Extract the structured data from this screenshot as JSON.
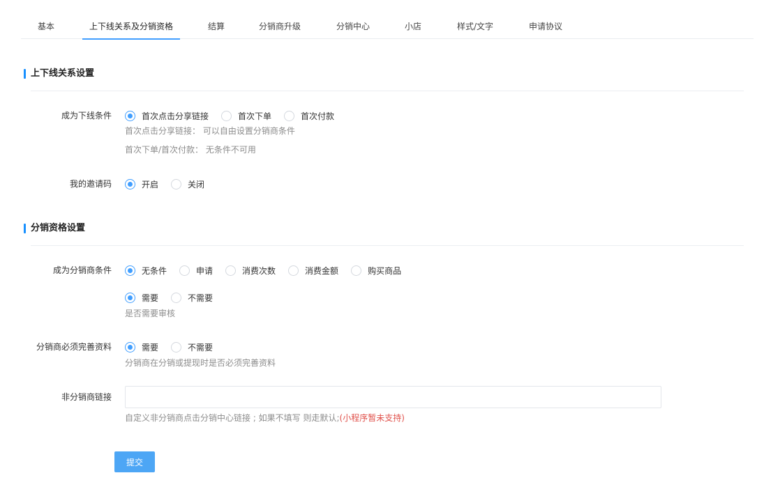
{
  "tabs": [
    {
      "label": "基本"
    },
    {
      "label": "上下线关系及分销资格",
      "active": true
    },
    {
      "label": "结算"
    },
    {
      "label": "分销商升级"
    },
    {
      "label": "分销中心"
    },
    {
      "label": "小店"
    },
    {
      "label": "样式/文字"
    },
    {
      "label": "申请协议"
    }
  ],
  "section_relation": {
    "title": "上下线关系设置",
    "downline_condition": {
      "label": "成为下线条件",
      "options": [
        "首次点击分享链接",
        "首次下单",
        "首次付款"
      ],
      "selected": 0,
      "help1": "首次点击分享链接： 可以自由设置分销商条件",
      "help2": "首次下单/首次付款： 无条件不可用"
    },
    "invite_code": {
      "label": "我的邀请码",
      "options": [
        "开启",
        "关闭"
      ],
      "selected": 0
    }
  },
  "section_qualification": {
    "title": "分销资格设置",
    "distributor_condition": {
      "label": "成为分销商条件",
      "options": [
        "无条件",
        "申请",
        "消费次数",
        "消费金额",
        "购买商品"
      ],
      "selected": 0
    },
    "review": {
      "options": [
        "需要",
        "不需要"
      ],
      "selected": 0,
      "help": "是否需要审核"
    },
    "complete_profile": {
      "label": "分销商必须完善资料",
      "options": [
        "需要",
        "不需要"
      ],
      "selected": 0,
      "help": "分销商在分销或提现时是否必须完善资料"
    },
    "non_distributor_link": {
      "label": "非分销商链接",
      "value": "",
      "help": "自定义非分销商点击分销中心链接 ; 如果不填写 则走默认;",
      "help_warn": "(小程序暂未支持)"
    }
  },
  "submit_label": "提交"
}
